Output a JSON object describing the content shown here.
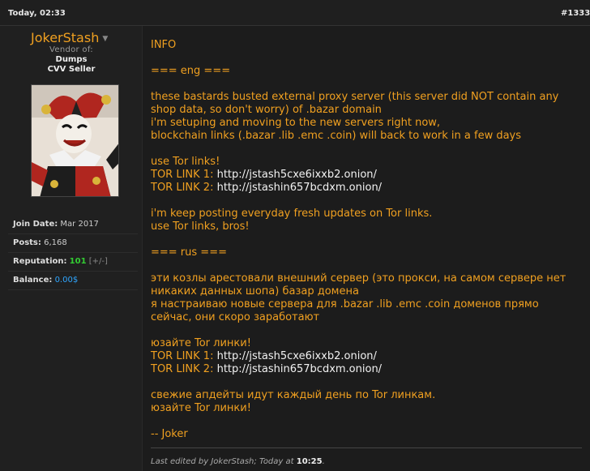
{
  "post": {
    "date": "Today, 02:33",
    "number": "#1333"
  },
  "user": {
    "name": "JokerStash",
    "vendor_of": "Vendor of:",
    "categories": [
      "Dumps",
      "CVV Seller"
    ],
    "join_label": "Join Date:",
    "join_value": "Mar 2017",
    "posts_label": "Posts:",
    "posts_value": "6,168",
    "rep_label": "Reputation:",
    "rep_value": "101",
    "rep_extra": "[+/-]",
    "balance_label": "Balance:",
    "balance_value": "0.00$"
  },
  "message": {
    "info": "INFO",
    "eng_heading": "=== eng ===",
    "eng_1": "these bastards busted external proxy server (this server did NOT contain any",
    "eng_2": "shop data, so don't worry) of .bazar domain",
    "eng_3": "i'm setuping and moving to the new servers right now,",
    "eng_4": "blockchain links (.bazar .lib .emc .coin) will back to work in a few days",
    "use_tor": "use Tor links!",
    "tor1_label": "TOR LINK 1:",
    "tor1_url": "http://jstash5cxe6ixxb2.onion/",
    "tor2_label": "TOR LINK 2:",
    "tor2_url": "http://jstashin657bcdxm.onion/",
    "eng_5": "i'm keep posting everyday fresh updates on Tor links.",
    "eng_6": "use Tor links, bros!",
    "rus_heading": "=== rus ===",
    "rus_1": "эти козлы арестовали внешний сервер (это прокси, на самом сервере нет",
    "rus_2": "никаких данных шопа) базар домена",
    "rus_3": "я настраиваю новые сервера для .bazar .lib .emc .coin доменов прямо",
    "rus_4": "сейчас, они скоро заработают",
    "rus_use_tor": "юзайте Tor линки!",
    "rus_5": "свежие апдейты идут каждый день по Tor линкам.",
    "rus_6": "юзайте Tor линки!",
    "sign": "-- Joker"
  },
  "edit": {
    "prefix": "Last edited by JokerStash; Today at",
    "time": "10:25",
    "suffix": "."
  },
  "icons": {
    "user_menu": "chevron-down-icon",
    "avatar": "joker-avatar-image"
  },
  "colors": {
    "message_text": "#f0a020",
    "link_text": "#f2f2f2",
    "reputation": "#33cc33",
    "balance": "#2fa6ff",
    "background": "#1c1c1c"
  }
}
